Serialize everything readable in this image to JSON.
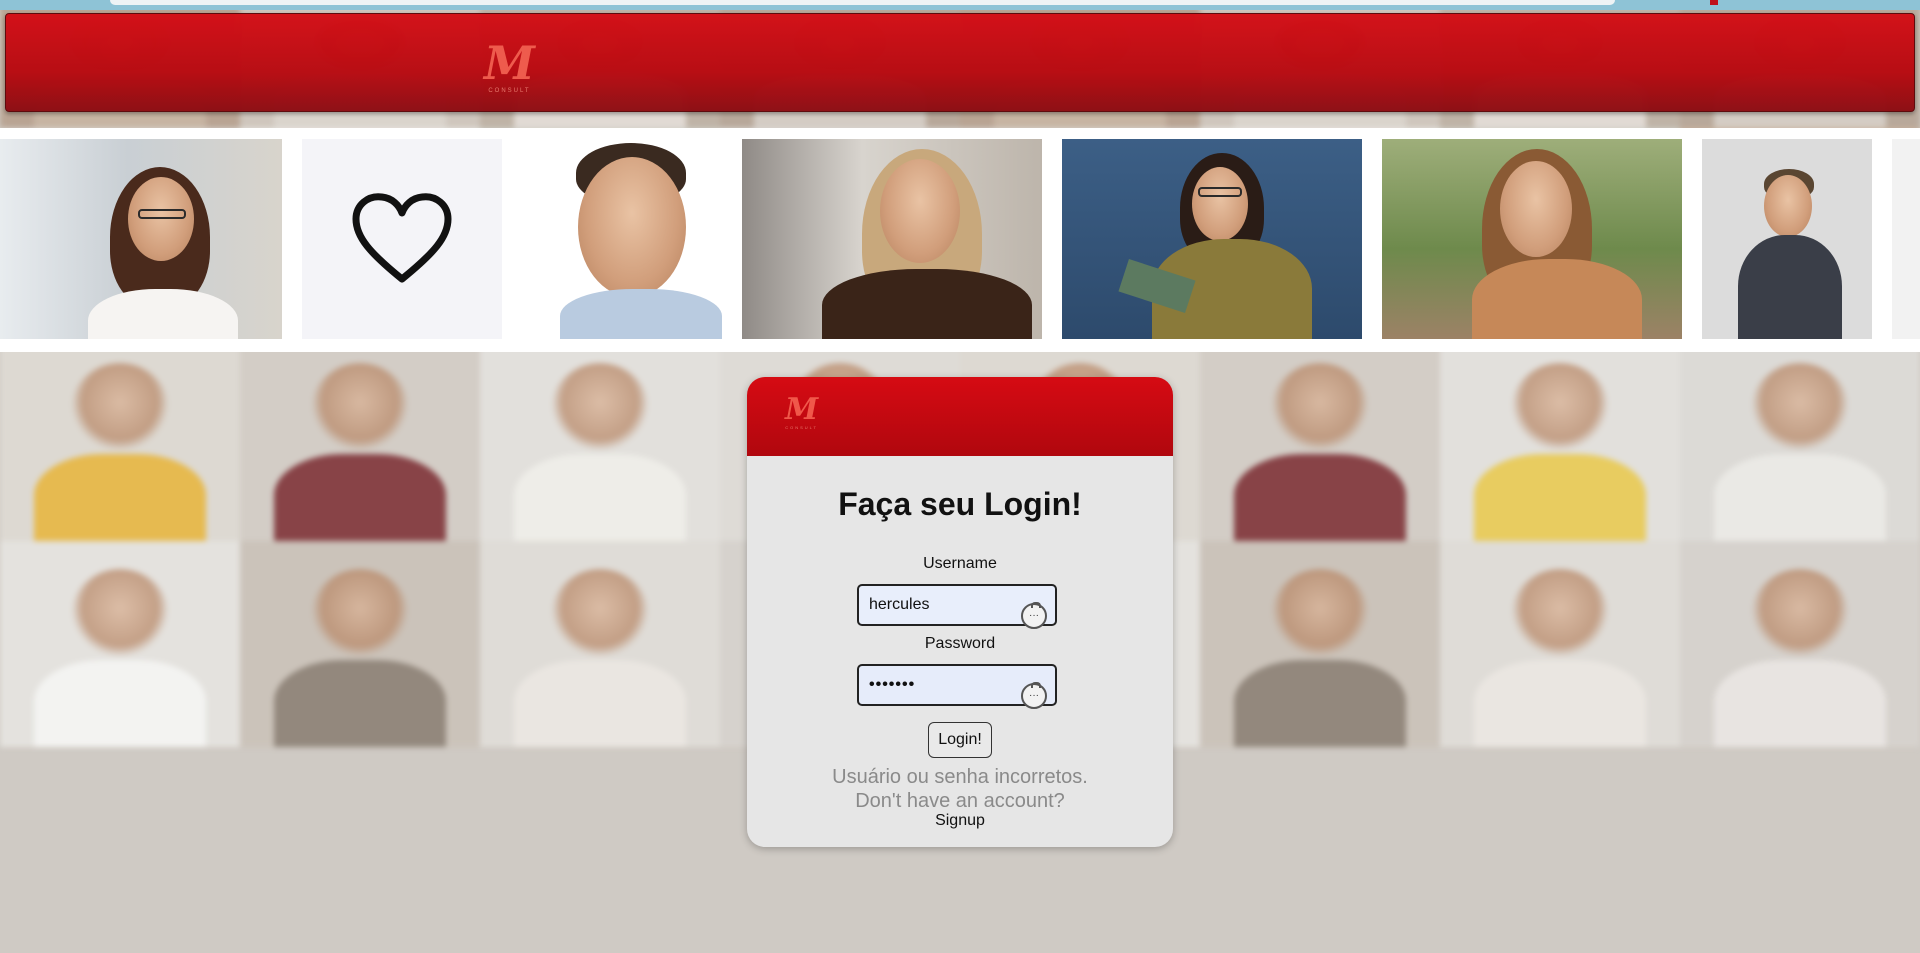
{
  "header": {
    "logo_mark": "M",
    "logo_text": "CONSULT"
  },
  "login": {
    "logo_mark": "M",
    "logo_text": "CONSULT",
    "title": "Faça seu Login!",
    "username_label": "Username",
    "username_value": "hercules",
    "password_label": "Password",
    "password_value": "•••••••",
    "submit_label": "Login!",
    "error_message": "Usuário ou senha incorretos.",
    "no_account_text": "Don't have an account?",
    "signup_label": "Signup",
    "password_manager_icon": "···"
  },
  "colors": {
    "brand_red": "#c8080f",
    "card_bg": "#e6e6e6",
    "error_text": "#8a8a8a"
  },
  "icons": [
    "heart-icon",
    "password-manager-icon"
  ]
}
